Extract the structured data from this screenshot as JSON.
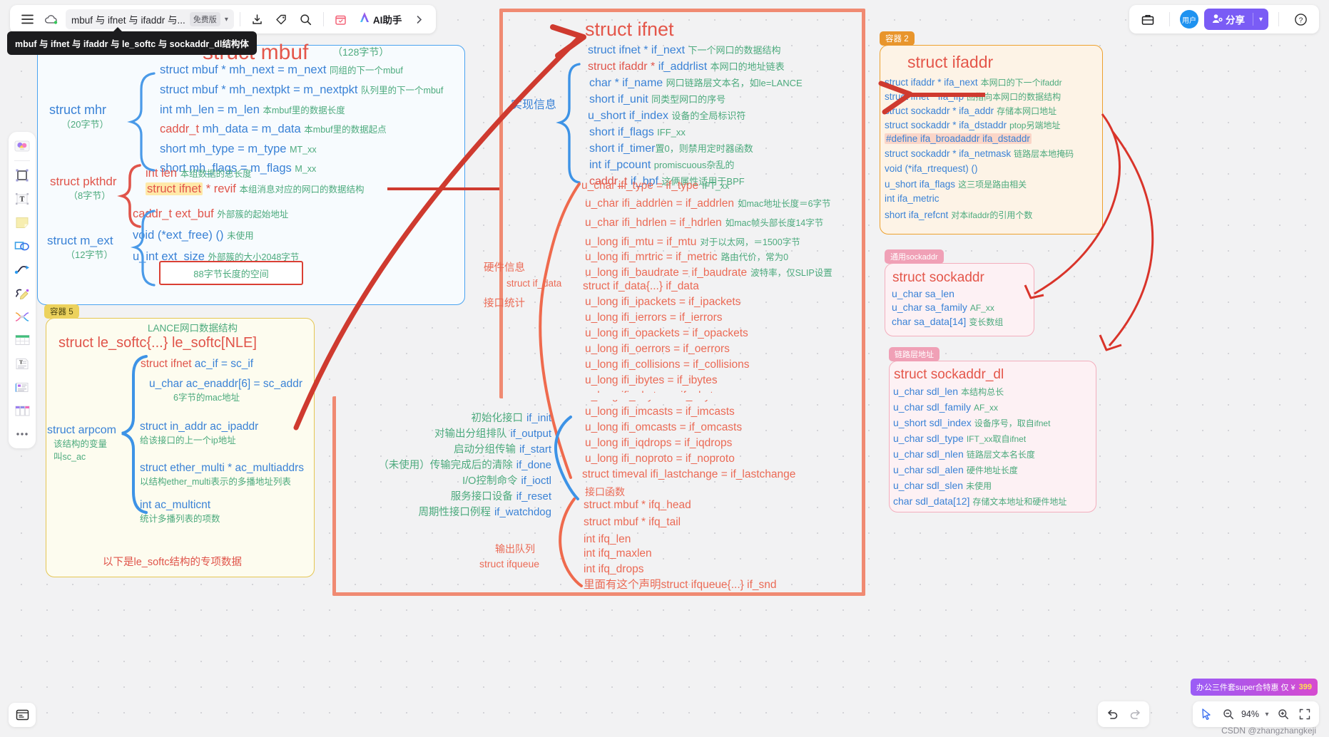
{
  "window": {
    "tooltip": "mbuf 与 ifnet 与 ifaddr 与 le_softc 与 sockaddr_dl结构体",
    "doc_title": "mbuf 与 ifnet 与 ifaddr 与...",
    "free_badge": "免费版",
    "ai_label": "AI助手",
    "avatar_label": "用户",
    "share_label": "分享",
    "zoom_level": "94%",
    "promo_text": "办公三件套super合特惠 仅 ¥",
    "promo_price": "399",
    "credit": "CSDN @zhangzhangkeji"
  },
  "frames": {
    "container2": "容器 2",
    "container5": "容器 5",
    "generic_sockaddr": "通用sockaddr",
    "link_layer_addr": "链路层地址"
  },
  "mbuf": {
    "title": "struct mbuf",
    "size": "（128字节）",
    "groups": [
      {
        "name": "struct mhr",
        "size": "（20字节）"
      },
      {
        "name": "struct pkthdr",
        "size": "（8字节）"
      },
      {
        "name": "struct m_ext",
        "size": "（12字节）"
      }
    ],
    "mhr_fields": [
      {
        "type": "struct mbuf * ",
        "name": "mh_next = m_next",
        "note": "同组的下一个mbuf"
      },
      {
        "type": "struct mbuf * ",
        "name": "mh_nextpkt = m_nextpkt",
        "note": "队列里的下一个mbuf"
      },
      {
        "type": "int ",
        "name": "mh_len = m_len",
        "note": "本mbuf里的数据长度"
      },
      {
        "type": "caddr_t ",
        "name": "mh_data = m_data",
        "note": "本mbuf里的数据起点"
      },
      {
        "type": "short ",
        "name": "mh_type = m_type",
        "note": "MT_xx"
      },
      {
        "type": "short ",
        "name": "mh_flags = m_flags",
        "note": "M_xx"
      }
    ],
    "pkthdr_fields": [
      {
        "name": "int len",
        "note": "本组数据的总长度"
      },
      {
        "name": "struct ifnet",
        "rest": " * revif",
        "note": "本组消息对应的网口的数据结构"
      }
    ],
    "mext_fields": [
      {
        "name": "caddr_t  ext_buf",
        "note": "外部簇的起始地址"
      },
      {
        "name": "void (*ext_free) ()",
        "note": "未使用"
      },
      {
        "name": "u_int ext_size",
        "note": "外部簇的大小2048字节"
      }
    ],
    "space_box": "88字节长度的空间"
  },
  "le_softc": {
    "subtitle": "LANCE网口数据结构",
    "title": "struct le_softc{...} le_softc[NLE]",
    "group_name": "struct arpcom",
    "group_note1": "该结构的变量",
    "group_note2": "叫sc_ac",
    "fields": [
      {
        "head": "struct ifnet",
        "rest": "  ac_if  = sc_if",
        "note": ""
      },
      {
        "head": "",
        "rest": "u_char  ac_enaddr[6] = sc_addr",
        "note": "6字节的mac地址"
      },
      {
        "head": "",
        "rest": "struct in_addr ac_ipaddr",
        "note": "给该接口的上一个ip地址"
      },
      {
        "head": "",
        "rest": "struct ether_multi * ac_multiaddrs",
        "note": "以结构ether_multi表示的多播地址列表"
      },
      {
        "head": "",
        "rest": "int ac_multicnt",
        "note": "统计多播列表的项数"
      }
    ],
    "footer": "以下是le_softc结构的专项数据"
  },
  "ifnet": {
    "title": "struct  ifnet",
    "label_impl": "实现信息",
    "label_hw": "硬件信息",
    "label_ifdata": "struct if_data",
    "label_stats": "接口统计",
    "label_funcs": "接口函数",
    "label_queue1": "输出队列",
    "label_queue2": "struct ifqueue",
    "impl_fields": [
      {
        "type": "struct ifnet * ",
        "name": "if_next",
        "note": "下一个网口的数据结构",
        "nameColor": "blue",
        "typeColor": "blue"
      },
      {
        "type": "struct ifaddr * ",
        "name": "if_addrlist",
        "note": "本网口的地址链表",
        "nameColor": "blue",
        "typeColor": "red"
      },
      {
        "type": "char * ",
        "name": "if_name",
        "note": "网口链路层文本名，如le=LANCE",
        "nameColor": "blue",
        "typeColor": "blue"
      },
      {
        "type": "short ",
        "name": "if_unit",
        "note": "同类型网口的序号",
        "nameColor": "blue",
        "typeColor": "blue"
      },
      {
        "type": "u_short ",
        "name": "if_index",
        "note": "设备的全局标识符",
        "nameColor": "blue",
        "typeColor": "blue"
      },
      {
        "type": "short ",
        "name": "if_flags",
        "note": "IFF_xx",
        "nameColor": "blue",
        "typeColor": "blue"
      },
      {
        "type": "short ",
        "name": "if_timer",
        "note": "置0，则禁用定时器函数",
        "nameColor": "blue",
        "typeColor": "blue"
      },
      {
        "type": "int ",
        "name": "if_pcount",
        "note": "promiscuous杂乱的",
        "nameColor": "blue",
        "typeColor": "blue"
      },
      {
        "type": "caddr_t ",
        "name": "  if_bpf",
        "note": "这俩属性适用于BPF",
        "nameColor": "blue",
        "typeColor": "red"
      }
    ],
    "data_fields": [
      {
        "name": "u_char ifi_type = if_type",
        "note": "IFT_xx"
      },
      {
        "name": "u_char ifi_addrlen = if_addrlen",
        "note": "如mac地址长度＝6字节"
      },
      {
        "name": "u_char ifi_hdrlen = if_hdrlen",
        "note": "如mac帧头部长度14字节"
      },
      {
        "name": "u_long ifi_mtu = if_mtu",
        "note": "对于以太网，＝1500字节"
      },
      {
        "name": "u_long ifi_mrtric = if_metric",
        "note": "路由代价，常为0"
      },
      {
        "name": "u_long ifi_baudrate = if_baudrate",
        "note": "波特率，仅SLIP设置"
      },
      {
        "name": "struct if_data{...} if_data",
        "note": ""
      },
      {
        "name": "u_long ifi_ipackets = if_ipackets",
        "note": ""
      },
      {
        "name": "u_long ifi_ierrors = if_ierrors",
        "note": ""
      },
      {
        "name": "u_long ifi_opackets = if_opackets",
        "note": ""
      },
      {
        "name": "u_long ifi_oerrors = if_oerrors",
        "note": ""
      },
      {
        "name": "u_long ifi_collisions = if_collisions",
        "note": ""
      },
      {
        "name": "u_long ifi_ibytes = if_ibytes",
        "note": ""
      },
      {
        "name": "u_long ifi_obytes = if_obytes",
        "note": ""
      },
      {
        "name": "u_long ifi_imcasts = if_imcasts",
        "note": ""
      },
      {
        "name": "u_long ifi_omcasts = if_omcasts",
        "note": ""
      },
      {
        "name": "u_long ifi_iqdrops = if_iqdrops",
        "note": ""
      },
      {
        "name": "u_long ifi_noproto = if_noproto",
        "note": ""
      },
      {
        "name": "struct timeval ifi_lastchange = if_lastchange",
        "note": ""
      }
    ],
    "func_fields": [
      {
        "note": "初始化接口",
        "name": "if_init"
      },
      {
        "note": "对输出分组排队",
        "name": "if_output"
      },
      {
        "note": "启动分组传输",
        "name": "if_start"
      },
      {
        "note": "（未使用）传输完成后的清除",
        "name": "if_done"
      },
      {
        "note": "I/O控制命令",
        "name": "if_ioctl"
      },
      {
        "note": "服务接口设备",
        "name": "if_reset"
      },
      {
        "note": "周期性接口例程",
        "name": "if_watchdog"
      }
    ],
    "queue_fields": [
      "struct mbuf * ifq_head",
      "struct mbuf * ifq_tail",
      "int ifq_len",
      "int ifq_maxlen",
      "int ifq_drops",
      "里面有这个声明struct ifqueue{...} if_snd"
    ]
  },
  "ifaddr": {
    "title": "struct ifaddr",
    "fields": [
      {
        "text": "struct ifaddr * ifa_next",
        "note": "本网口的下一个ifaddr",
        "hl": false
      },
      {
        "text": "struct ifnet * ifa_ifp",
        "note": "回指向本网口的数据结构",
        "hl": false
      },
      {
        "text": "struct sockaddr * ifa_addr",
        "note": "存储本网口地址",
        "hl": false
      },
      {
        "text": "struct sockaddr * ifa_dstaddr",
        "note": "ptop另端地址",
        "hl": false
      },
      {
        "text": "#define ifa_broadaddr ifa_dstaddr",
        "note": "",
        "hl": true
      },
      {
        "text": "struct sockaddr * ifa_netmask",
        "note": "链路层本地掩码",
        "hl": false
      },
      {
        "text": "void (*ifa_rtrequest) ()",
        "note": "",
        "hl": false
      },
      {
        "text": "u_short ifa_flags",
        "note": "这三项是路由相关",
        "hl": false
      },
      {
        "text": "int ifa_metric",
        "note": "",
        "hl": false
      },
      {
        "text": "short ifa_refcnt",
        "note": "对本ifaddr的引用个数",
        "hl": false
      }
    ]
  },
  "sockaddr": {
    "title": "struct sockaddr",
    "fields": [
      {
        "text": "u_char sa_len",
        "note": ""
      },
      {
        "text": "u_char sa_family",
        "note": "AF_xx"
      },
      {
        "text": "char sa_data[14]",
        "note": "变长数组"
      }
    ]
  },
  "sockaddr_dl": {
    "title": "struct sockaddr_dl",
    "fields": [
      {
        "text": "u_char sdl_len",
        "note": "本结构总长"
      },
      {
        "text": "u_char sdl_family",
        "note": "AF_xx"
      },
      {
        "text": "u_short sdl_index",
        "note": "设备序号，取自ifnet"
      },
      {
        "text": "u_char sdl_type",
        "note": "IFT_xx取自ifnet"
      },
      {
        "text": "u_char sdl_nlen",
        "note": "链路层文本名长度"
      },
      {
        "text": "u_char sdl_alen",
        "note": "硬件地址长度"
      },
      {
        "text": "u_char sdl_slen",
        "note": "未使用"
      },
      {
        "text": "char sdl_data[12]",
        "note": "存储文本地址和硬件地址"
      }
    ]
  },
  "colors": {
    "accent_purple": "#7a5cf5",
    "blue": "#3a82d6",
    "red": "#e0544a",
    "green": "#4caa7d",
    "frame_orange": "#f08a72"
  }
}
